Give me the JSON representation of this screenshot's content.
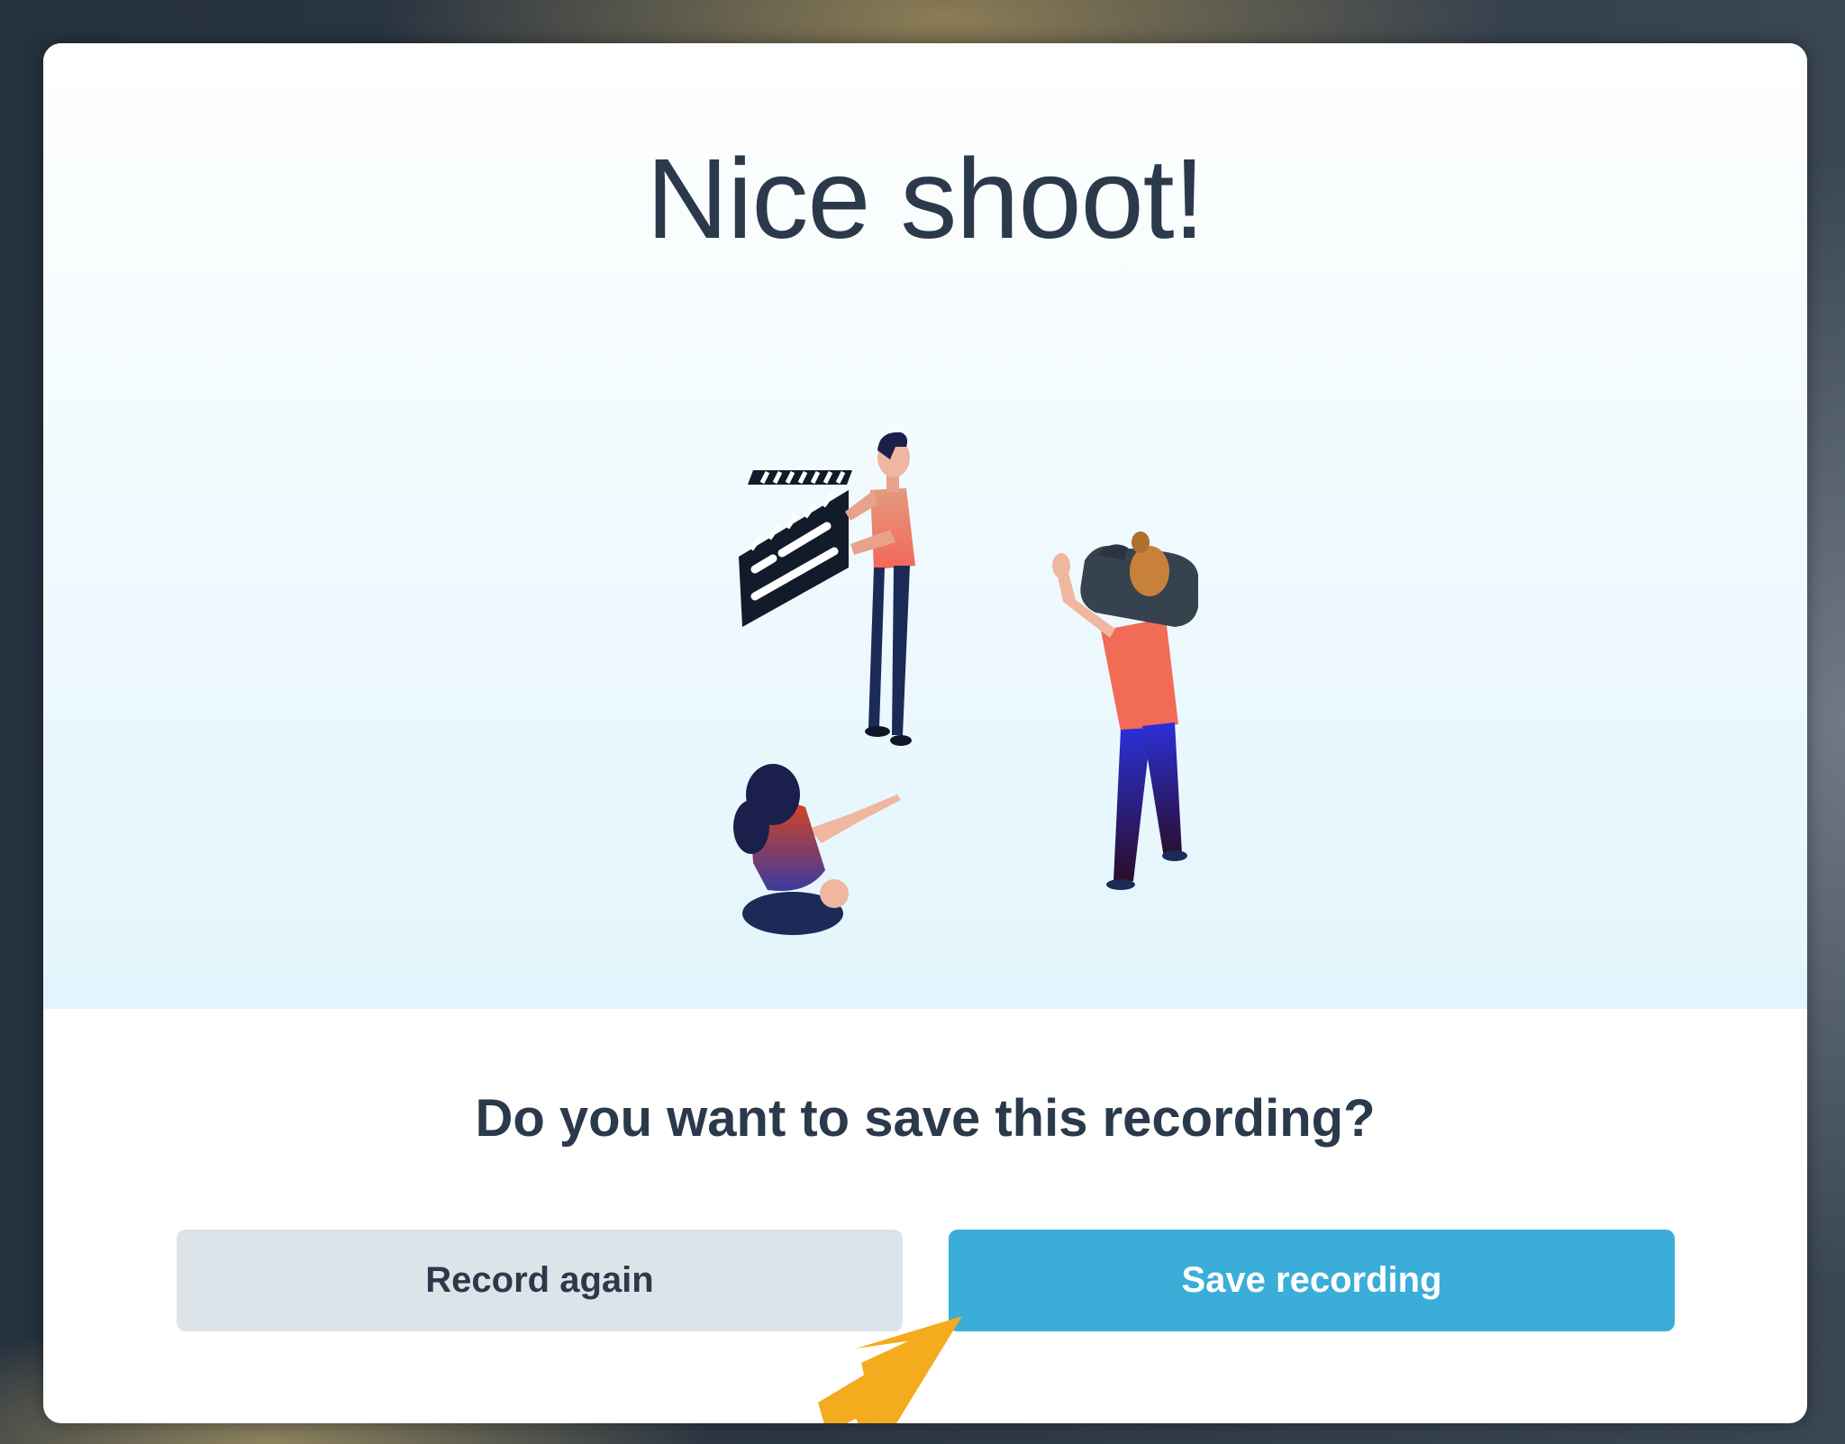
{
  "dialog": {
    "title": "Nice shoot!",
    "question": "Do you want to save this recording?",
    "illustration_icon": "film-crew-illustration",
    "secondary_button": {
      "label": "Record again"
    },
    "primary_button": {
      "label": "Save recording"
    },
    "pointer_icon": "arrow-pointer-icon"
  },
  "colors": {
    "title_text": "#2b3a4b",
    "primary_button": "#3badd9",
    "secondary_button": "#dde4e9",
    "pointer_arrow": "#f5ab1e",
    "shirt": "#f26b57"
  }
}
